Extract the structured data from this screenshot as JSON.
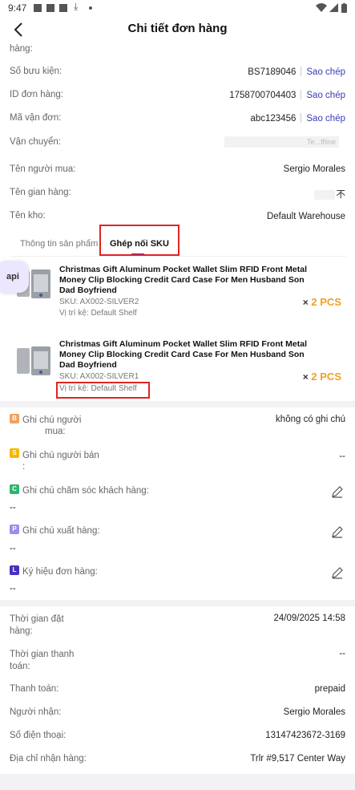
{
  "status_bar": {
    "time": "9:47"
  },
  "header": {
    "title": "Chi tiết đơn hàng",
    "back_icon": "chevron-left-icon"
  },
  "order_info": {
    "cut_label": "hàng:",
    "package_no": {
      "label": "Số bưu kiện:",
      "value": "BS7189046",
      "copy": "Sao chép"
    },
    "order_id": {
      "label": "ID đơn hàng:",
      "value": "1758700704403",
      "copy": "Sao chép"
    },
    "waybill": {
      "label": "Mã vận đơn:",
      "value": "abc123456",
      "copy": "Sao chép"
    },
    "shipping": {
      "label": "Vận chuyển:",
      "value": "Te...ffline"
    },
    "buyer": {
      "label": "Tên người mua:",
      "value": "Sergio Morales"
    },
    "store": {
      "label": "Tên gian hàng:",
      "value": "不"
    },
    "warehouse": {
      "label": "Tên kho:",
      "value": "Default Warehouse"
    }
  },
  "tabs": {
    "product_info": "Thông tin sản phẩm",
    "sku_pairing": "Ghép nối SKU"
  },
  "floating_button": {
    "label": "api"
  },
  "products": [
    {
      "name": "Christmas Gift Aluminum Pocket Wallet Slim RFID Front Metal Money Clip Blocking Credit Card Case For Men Husband Son Dad Boyfriend",
      "sku": "SKU: AX002-SILVER2",
      "shelf": "Vị trí kệ: Default Shelf",
      "qty_x": "×",
      "qty": "2 PCS"
    },
    {
      "name": "Christmas Gift Aluminum Pocket Wallet Slim RFID Front Metal Money Clip Blocking Credit Card Case For Men Husband Son Dad Boyfriend",
      "sku": "SKU: AX002-SILVER1",
      "shelf": "Vị trí kệ: Default Shelf",
      "qty_x": "×",
      "qty": "2 PCS"
    }
  ],
  "notes": {
    "buyer_note": {
      "badge": "B",
      "label_line1": "Ghi chú người",
      "label_line2": "mua:",
      "value": "không có ghi chú"
    },
    "seller_note": {
      "badge": "S",
      "label_line1": "Ghi chú người bán",
      "label_line2": ":",
      "value": "--"
    },
    "cs_note": {
      "badge": "C",
      "label": "Ghi chú chăm sóc khách hàng:",
      "value": "--"
    },
    "export_note": {
      "badge": "P",
      "label": "Ghi chú xuất hàng:",
      "value": "--"
    },
    "order_mark": {
      "badge": "L",
      "label": "Ký hiệu đơn hàng:",
      "value": "--"
    }
  },
  "details": {
    "order_time": {
      "label_line1": "Thời gian đặt",
      "label_line2": "hàng:",
      "value": "24/09/2025 14:58"
    },
    "payment_time": {
      "label_line1": "Thời gian thanh",
      "label_line2": "toán:",
      "value": "--"
    },
    "payment": {
      "label": "Thanh toán:",
      "value": "prepaid"
    },
    "recipient": {
      "label": "Người nhận:",
      "value": "Sergio Morales"
    },
    "phone": {
      "label": "Số điện thoại:",
      "value": "13147423672-3169"
    },
    "address": {
      "label": "Địa chỉ nhận hàng:",
      "value": "Trlr #9,517 Center Way"
    }
  },
  "colors": {
    "accent": "#3b3bb8",
    "qty": "#f0a028",
    "highlight": "#e02424",
    "badge_b": "#f0a060",
    "badge_s": "#f5b800",
    "badge_c": "#2bb673",
    "badge_p": "#9b8cf0",
    "badge_l": "#4a2fc0"
  }
}
